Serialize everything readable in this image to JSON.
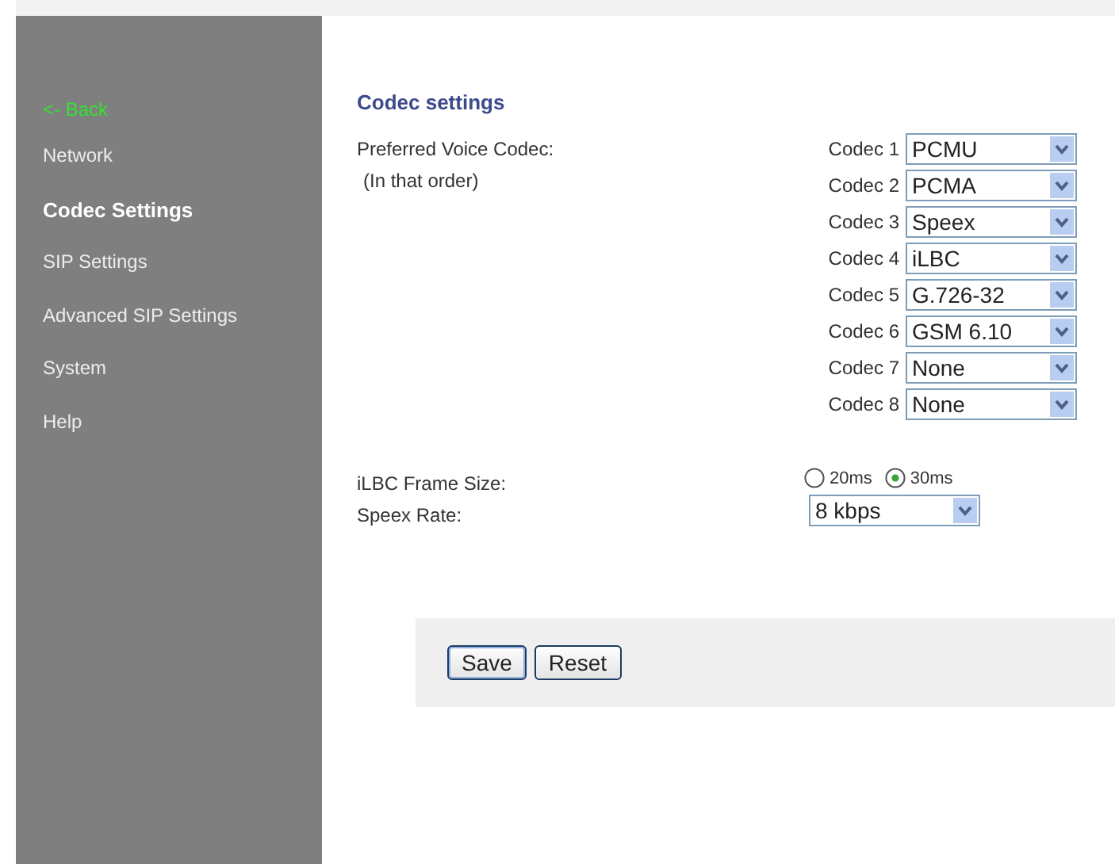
{
  "sidebar": {
    "back_link": "<- Back",
    "items": [
      {
        "label": "Network",
        "selected": false
      },
      {
        "label": "Codec Settings",
        "selected": true
      },
      {
        "label": "SIP Settings",
        "selected": false
      },
      {
        "label": "Advanced SIP Settings",
        "selected": false
      },
      {
        "label": "System",
        "selected": false
      },
      {
        "label": "Help",
        "selected": false
      }
    ]
  },
  "heading": "Codec settings",
  "preferred_label": "Preferred Voice Codec:",
  "order_note": "(In that order)",
  "codecs": [
    {
      "label": "Codec 1",
      "value": "PCMU"
    },
    {
      "label": "Codec 2",
      "value": "PCMA"
    },
    {
      "label": "Codec 3",
      "value": "Speex"
    },
    {
      "label": "Codec 4",
      "value": "iLBC"
    },
    {
      "label": "Codec 5",
      "value": "G.726-32"
    },
    {
      "label": "Codec 6",
      "value": "GSM 6.10"
    },
    {
      "label": "Codec 7",
      "value": "None"
    },
    {
      "label": "Codec 8",
      "value": "None"
    }
  ],
  "ilbc_frame_size": {
    "label": "iLBC Frame Size:",
    "options": [
      {
        "label": "20ms",
        "selected": false
      },
      {
        "label": "30ms",
        "selected": true
      }
    ]
  },
  "speex_rate": {
    "label": "Speex Rate:",
    "value": "8 kbps"
  },
  "buttons": [
    "Save",
    "Reset"
  ]
}
